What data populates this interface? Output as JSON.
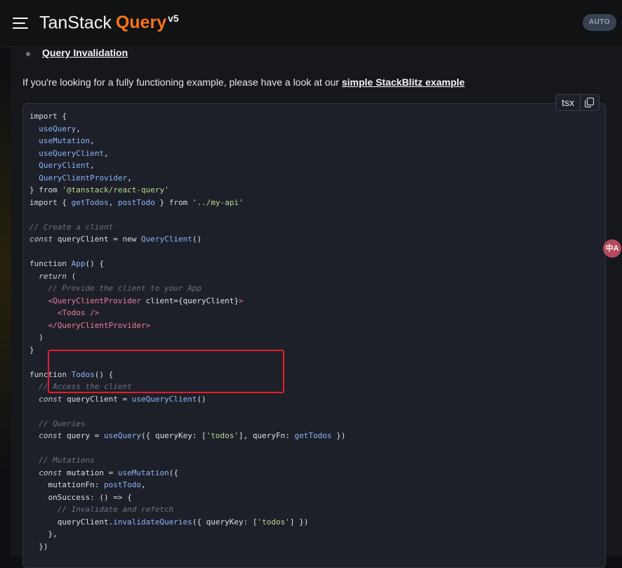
{
  "header": {
    "brand_name": "TanStack",
    "brand_product": "Query",
    "brand_version": "v5",
    "theme_toggle": "AUTO"
  },
  "content": {
    "bullet_link": "Query Invalidation",
    "intro_text": "If you're looking for a fully functioning example, please have a look at our ",
    "intro_link": "simple StackBlitz example"
  },
  "code_block": {
    "language": "tsx",
    "lines": [
      "import {",
      "  useQuery,",
      "  useMutation,",
      "  useQueryClient,",
      "  QueryClient,",
      "  QueryClientProvider,",
      "} from '@tanstack/react-query'",
      "import { getTodos, postTodo } from '../my-api'",
      "",
      "// Create a client",
      "const queryClient = new QueryClient()",
      "",
      "function App() {",
      "  return (",
      "    // Provide the client to your App",
      "    <QueryClientProvider client={queryClient}>",
      "      <Todos />",
      "    </QueryClientProvider>",
      "  )",
      "}",
      "",
      "function Todos() {",
      "  // Access the client",
      "  const queryClient = useQueryClient()",
      "",
      "  // Queries",
      "  const query = useQuery({ queryKey: ['todos'], queryFn: getTodos })",
      "",
      "  // Mutations",
      "  const mutation = useMutation({",
      "    mutationFn: postTodo,",
      "    onSuccess: () => {",
      "      // Invalidate and refetch",
      "      queryClient.invalidateQueries({ queryKey: ['todos'] })",
      "    },",
      "  })"
    ]
  },
  "icons": {
    "menu": "hamburger-menu-icon",
    "copy": "copy-icon",
    "translate": "translate-icon"
  },
  "colors": {
    "brand_accent": "#f97316",
    "highlight_box": "#e11d2a",
    "code_background": "#1e2029"
  },
  "overlay": {
    "translate_glyph": "中A"
  }
}
